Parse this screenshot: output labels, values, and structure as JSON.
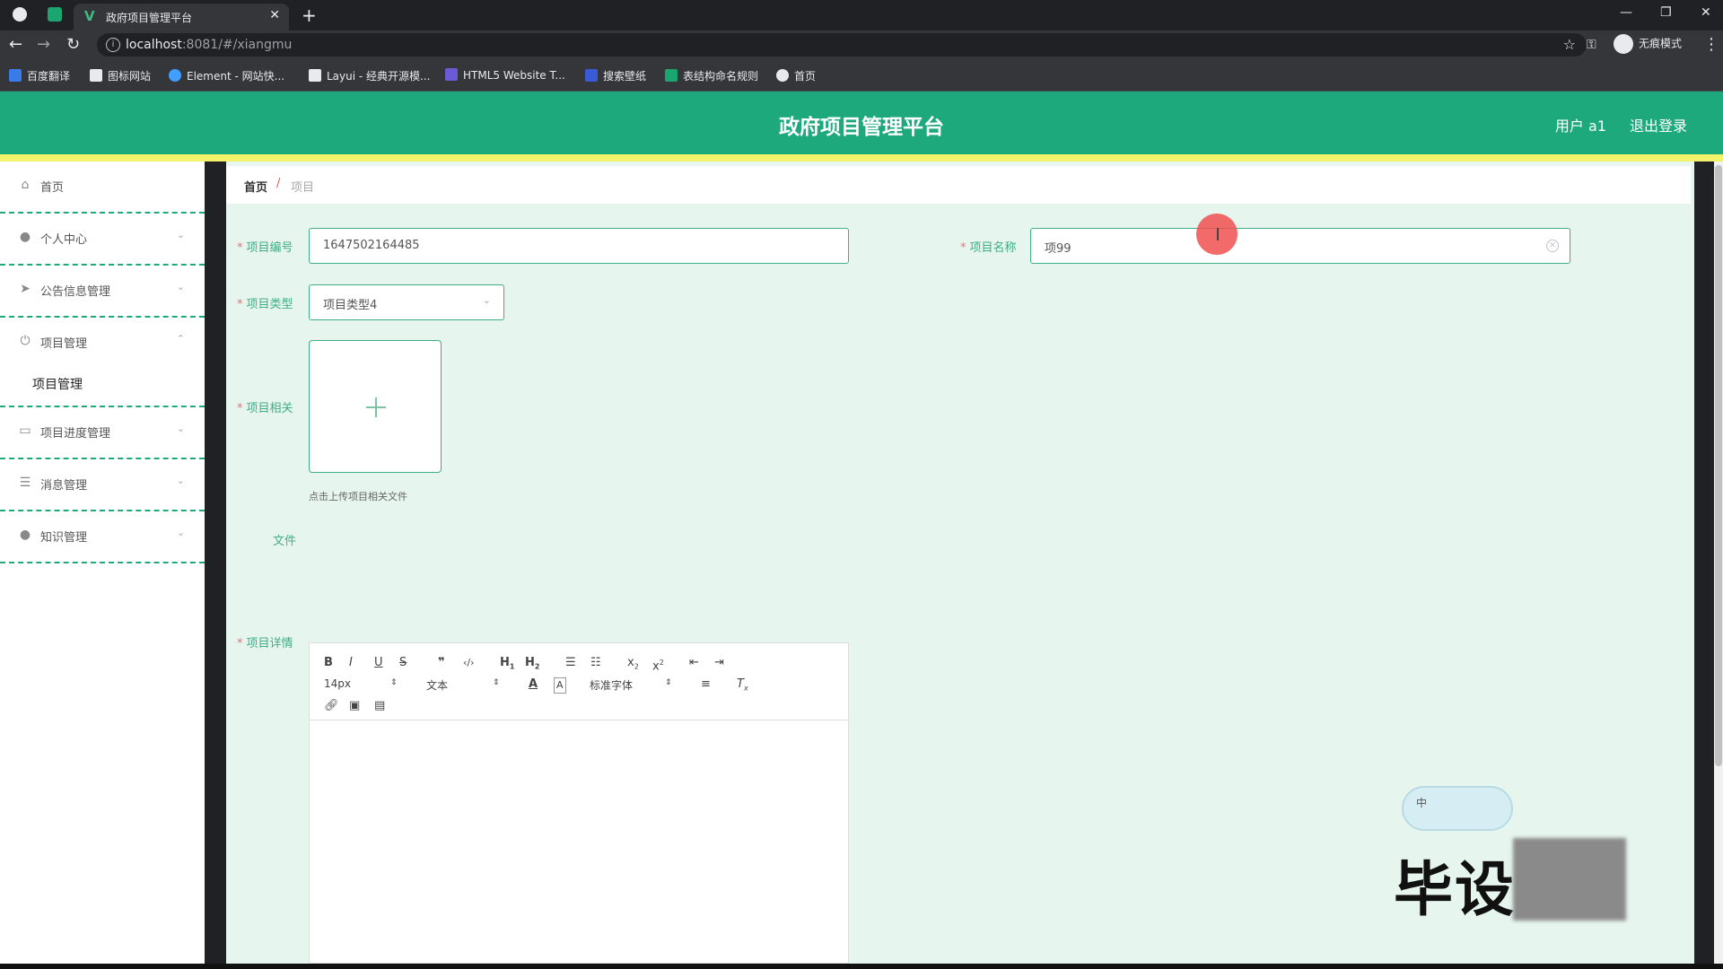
{
  "browser": {
    "tab_title": "政府项目管理平台",
    "url_host": "localhost",
    "url_rest": ":8081/#/xiangmu",
    "incognito_label": "无痕模式",
    "bookmarks": [
      {
        "label": "百度翻译",
        "color": "#3a7bea"
      },
      {
        "label": "图标网站",
        "color": "#e8eaed"
      },
      {
        "label": "Element - 网站快...",
        "color": "#409eff"
      },
      {
        "label": "Layui - 经典开源模...",
        "color": "#e8eaed"
      },
      {
        "label": "HTML5 Website T...",
        "color": "#6b5bd6"
      },
      {
        "label": "搜索壁纸",
        "color": "#3a5bd6"
      },
      {
        "label": "表结构命名规则",
        "color": "#1aa571"
      },
      {
        "label": "首页",
        "color": "#e8eaed"
      }
    ]
  },
  "header": {
    "title": "政府项目管理平台",
    "user": "用户 a1",
    "logout": "退出登录"
  },
  "sidebar": {
    "items": [
      {
        "label": "首页",
        "icon": "home-icon"
      },
      {
        "label": "个人中心",
        "icon": "user-icon"
      },
      {
        "label": "公告信息管理",
        "icon": "send-icon"
      },
      {
        "label": "项目管理",
        "icon": "power-icon"
      },
      {
        "label": "项目管理",
        "icon": ""
      },
      {
        "label": "项目进度管理",
        "icon": "panel-icon"
      },
      {
        "label": "消息管理",
        "icon": "sliders-icon"
      },
      {
        "label": "知识管理",
        "icon": "user-icon"
      }
    ]
  },
  "breadcrumb": {
    "home": "首页",
    "separator": "/",
    "current": "项目"
  },
  "form": {
    "code_label": "项目编号",
    "code_value": "1647502164485",
    "name_label": "项目名称",
    "name_value": "项99",
    "type_label": "项目类型",
    "type_value": "项目类型4",
    "file_label": "项目相关",
    "file_label_2": "文件",
    "upload_tip": "点击上传项目相关文件",
    "detail_label": "项目详情"
  },
  "editor": {
    "font_size": "14px",
    "heading": "文本",
    "font_family": "标准字体"
  },
  "overlay": {
    "ime": "中",
    "watermark": "毕设"
  },
  "colors": {
    "brand": "#1ea97c",
    "accent_band": "#f3f36b",
    "content_bg": "#e6f5ee",
    "required": "#f56c6c"
  }
}
